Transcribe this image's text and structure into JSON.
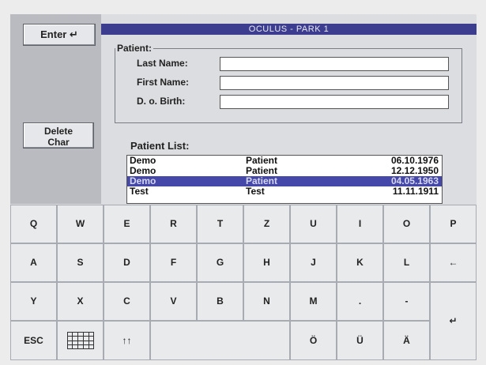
{
  "window": {
    "title": "OCULUS - PARK 1"
  },
  "side": {
    "enter_label": "Enter ↵",
    "delete_line1": "Delete",
    "delete_line2": "Char"
  },
  "patient_form": {
    "group_label": "Patient:",
    "last_name_label": "Last Name:",
    "first_name_label": "First Name:",
    "dob_label": "D. o. Birth:",
    "last_name_value": "",
    "first_name_value": "",
    "dob_value": ""
  },
  "patient_list": {
    "label": "Patient List:",
    "rows": [
      {
        "last": "Demo",
        "first": "Patient",
        "dob": "06.10.1976",
        "selected": false
      },
      {
        "last": "Demo",
        "first": "Patient",
        "dob": "12.12.1950",
        "selected": false
      },
      {
        "last": "Demo",
        "first": "Patient",
        "dob": "04.05.1963",
        "selected": true
      },
      {
        "last": "Test",
        "first": "Test",
        "dob": "11.11.1911",
        "selected": false
      }
    ]
  },
  "keyboard": {
    "row1": [
      "Q",
      "W",
      "E",
      "R",
      "T",
      "Z",
      "U",
      "I",
      "O",
      "P"
    ],
    "row2": [
      "A",
      "S",
      "D",
      "F",
      "G",
      "H",
      "J",
      "K",
      "L",
      "←"
    ],
    "row3": [
      "Y",
      "X",
      "C",
      "V",
      "B",
      "N",
      "M",
      ".",
      "-"
    ],
    "row4": [
      "ESC",
      "",
      "↑↑",
      "",
      "Ö",
      "Ü",
      "Ä"
    ],
    "enter": "↵"
  },
  "colors": {
    "titlebar": "#3c3d8e",
    "selection": "#4548a8"
  }
}
